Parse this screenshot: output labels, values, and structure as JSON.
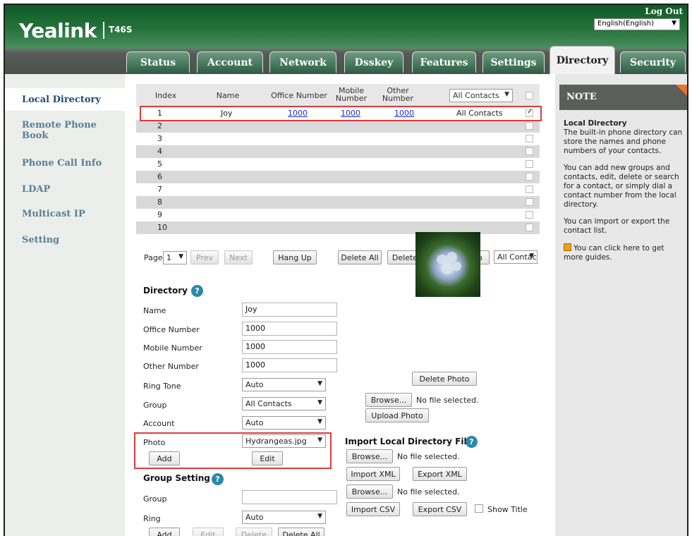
{
  "header": {
    "brand": "Yealink",
    "model": "T46S",
    "logout": "Log Out",
    "language": "English(English)"
  },
  "tabs": [
    "Status",
    "Account",
    "Network",
    "Dsskey",
    "Features",
    "Settings",
    "Directory",
    "Security"
  ],
  "active_tab": "Directory",
  "sidebar": {
    "items": [
      "Local Directory",
      "Remote Phone Book",
      "Phone Call Info",
      "LDAP",
      "Multicast IP",
      "Setting"
    ]
  },
  "contacts_table": {
    "headers": {
      "index": "Index",
      "name": "Name",
      "office": "Office Number",
      "mobile": "Mobile Number",
      "other": "Other Number",
      "group_filter": "All Contacts"
    },
    "rows": [
      {
        "index": "1",
        "name": "Joy",
        "office": "1000",
        "mobile": "1000",
        "other": "1000",
        "group": "All Contacts",
        "checked": true
      },
      {
        "index": "2",
        "name": "",
        "office": "",
        "mobile": "",
        "other": "",
        "group": "",
        "checked": false
      },
      {
        "index": "3",
        "name": "",
        "office": "",
        "mobile": "",
        "other": "",
        "group": "",
        "checked": false
      },
      {
        "index": "4",
        "name": "",
        "office": "",
        "mobile": "",
        "other": "",
        "group": "",
        "checked": false
      },
      {
        "index": "5",
        "name": "",
        "office": "",
        "mobile": "",
        "other": "",
        "group": "",
        "checked": false
      },
      {
        "index": "6",
        "name": "",
        "office": "",
        "mobile": "",
        "other": "",
        "group": "",
        "checked": false
      },
      {
        "index": "7",
        "name": "",
        "office": "",
        "mobile": "",
        "other": "",
        "group": "",
        "checked": false
      },
      {
        "index": "8",
        "name": "",
        "office": "",
        "mobile": "",
        "other": "",
        "group": "",
        "checked": false
      },
      {
        "index": "9",
        "name": "",
        "office": "",
        "mobile": "",
        "other": "",
        "group": "",
        "checked": false
      },
      {
        "index": "10",
        "name": "",
        "office": "",
        "mobile": "",
        "other": "",
        "group": "",
        "checked": false
      }
    ]
  },
  "pager": {
    "page_label": "Page",
    "page_value": "1",
    "prev": "Prev",
    "next": "Next",
    "hang_up": "Hang Up",
    "delete_all": "Delete All",
    "delete": "Delete",
    "move_to": "Move To",
    "move_target": "All Contac"
  },
  "directory_form": {
    "title": "Directory",
    "name_label": "Name",
    "name_value": "Joy",
    "office_label": "Office Number",
    "office_value": "1000",
    "mobile_label": "Mobile Number",
    "mobile_value": "1000",
    "other_label": "Other Number",
    "other_value": "1000",
    "ring_label": "Ring Tone",
    "ring_value": "Auto",
    "group_label": "Group",
    "group_value": "All Contacts",
    "account_label": "Account",
    "account_value": "Auto",
    "photo_label": "Photo",
    "photo_value": "Hydrangeas.jpg",
    "add": "Add",
    "edit": "Edit"
  },
  "photo_panel": {
    "delete_photo": "Delete Photo",
    "browse": "Browse...",
    "no_file": "No file selected.",
    "upload_photo": "Upload Photo"
  },
  "import_panel": {
    "title": "Import Local Directory File",
    "browse1": "Browse...",
    "no_file1": "No file selected.",
    "import_xml": "Import XML",
    "export_xml": "Export XML",
    "browse2": "Browse...",
    "no_file2": "No file selected.",
    "import_csv": "Import CSV",
    "export_csv": "Export CSV",
    "show_title": "Show Title"
  },
  "group_setting": {
    "title": "Group Setting",
    "group_label": "Group",
    "group_value": "",
    "ring_label": "Ring",
    "ring_value": "Auto",
    "add": "Add",
    "edit": "Edit",
    "delete": "Delete",
    "delete_all": "Delete All"
  },
  "note": {
    "title": "NOTE",
    "heading": "Local Directory",
    "p1": "The built-in phone directory can store the names and phone numbers of your contacts.",
    "p2": "You can add new groups and contacts, edit, delete or search for a contact, or simply dial a contact number from the local directory.",
    "p3": "You can import or export the contact list.",
    "p4": "You can click here to get more guides."
  },
  "colors": {
    "header_green": "#26723c",
    "nav_text": "#5a7f93",
    "highlight_red": "#e33a3a",
    "link_blue": "#1a31c9",
    "note_header": "#5b5e5b",
    "help_blue": "#2b8aa8"
  }
}
